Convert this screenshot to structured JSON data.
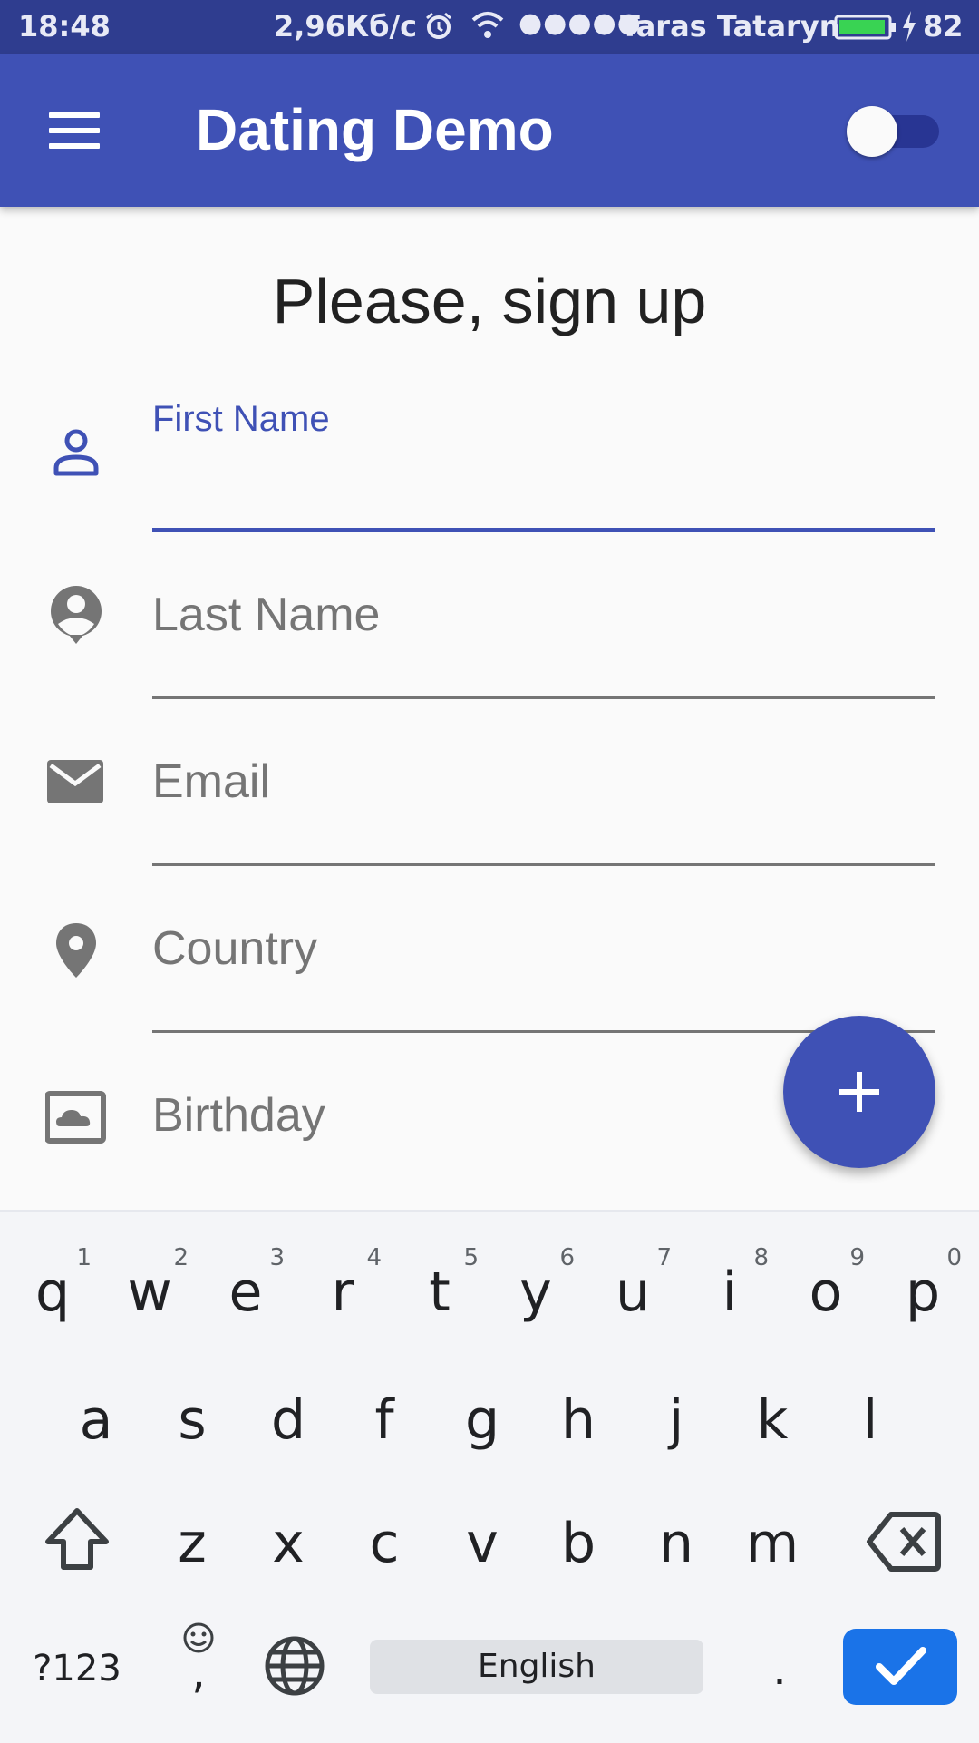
{
  "status_bar": {
    "time": "18:48",
    "speed": "2,96Кб/с",
    "signal_dots": "●●●●●",
    "carrier": "Taras Tataryn",
    "battery_percent": "82"
  },
  "app_bar": {
    "title": "Dating Demo",
    "toggle_on": false
  },
  "form": {
    "heading": "Please, sign up",
    "fields": [
      {
        "label": "First Name",
        "icon": "person-outline-icon",
        "active": true
      },
      {
        "label": "Last Name",
        "icon": "account-circle-icon",
        "active": false
      },
      {
        "label": "Email",
        "icon": "email-icon",
        "active": false
      },
      {
        "label": "Country",
        "icon": "place-icon",
        "active": false
      },
      {
        "label": "Birthday",
        "icon": "photo-cloud-icon",
        "active": false
      }
    ]
  },
  "fab": {
    "icon": "plus-icon"
  },
  "keyboard": {
    "row1": [
      {
        "ch": "q",
        "num": "1"
      },
      {
        "ch": "w",
        "num": "2"
      },
      {
        "ch": "e",
        "num": "3"
      },
      {
        "ch": "r",
        "num": "4"
      },
      {
        "ch": "t",
        "num": "5"
      },
      {
        "ch": "y",
        "num": "6"
      },
      {
        "ch": "u",
        "num": "7"
      },
      {
        "ch": "i",
        "num": "8"
      },
      {
        "ch": "o",
        "num": "9"
      },
      {
        "ch": "p",
        "num": "0"
      }
    ],
    "row2": [
      "a",
      "s",
      "d",
      "f",
      "g",
      "h",
      "j",
      "k",
      "l"
    ],
    "row3": [
      "z",
      "x",
      "c",
      "v",
      "b",
      "n",
      "m"
    ],
    "symbols_label": "?123",
    "emoji_comma": ",",
    "space_label": "English",
    "period": ".",
    "colors": {
      "accent": "#1a73e8",
      "primary": "#3f51b5",
      "status_bar": "#2f3d8f"
    }
  }
}
